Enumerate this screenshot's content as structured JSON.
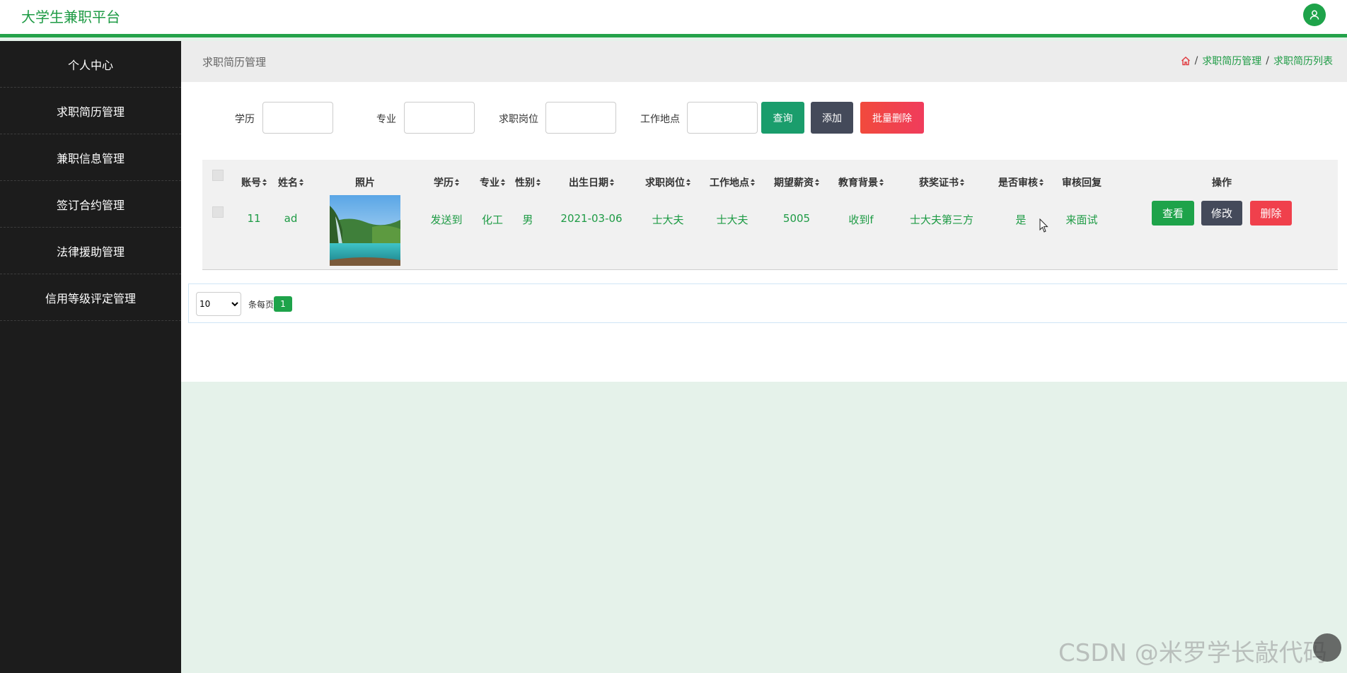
{
  "app": {
    "title": "大学生兼职平台"
  },
  "icons": {
    "avatar": "user-icon",
    "home": "home-icon"
  },
  "colors": {
    "accent": "#1ea34a",
    "sidebar": "#1c1c1c",
    "query": "#1a9d6c",
    "add": "#444a5a",
    "danger": "#f0404c"
  },
  "sidebar": {
    "items": [
      {
        "label": "个人中心"
      },
      {
        "label": "求职简历管理"
      },
      {
        "label": "兼职信息管理"
      },
      {
        "label": "签订合约管理"
      },
      {
        "label": "法律援助管理"
      },
      {
        "label": "信用等级评定管理"
      }
    ]
  },
  "breadcrumb": {
    "page_title": "求职简历管理",
    "level1": "求职简历管理",
    "level2": "求职简历列表",
    "sep": "/"
  },
  "search": {
    "f1_label": "学历",
    "f2_label": "专业",
    "f3_label": "求职岗位",
    "f4_label": "工作地点",
    "query_label": "查询",
    "add_label": "添加",
    "batch_delete_label": "批量删除"
  },
  "table": {
    "headers": {
      "account": "账号",
      "name": "姓名",
      "photo": "照片",
      "education": "学历",
      "major": "专业",
      "gender": "性别",
      "birth": "出生日期",
      "position": "求职岗位",
      "location": "工作地点",
      "salary": "期望薪资",
      "edu_bg": "教育背景",
      "cert": "获奖证书",
      "audited": "是否审核",
      "reply": "审核回复",
      "actions": "操作"
    },
    "rows": [
      {
        "account": "11",
        "name": "ad",
        "education": "发送到",
        "major": "化工",
        "gender": "男",
        "birth": "2021-03-06",
        "position": "士大夫",
        "location": "士大夫",
        "salary": "5005",
        "edu_bg": "收到f",
        "cert": "士大夫第三方",
        "audited": "是",
        "reply": "来面试",
        "view_label": "查看",
        "edit_label": "修改",
        "delete_label": "删除"
      }
    ]
  },
  "pagination": {
    "page_size": "10",
    "per_page_label": "条每页",
    "current_page": "1"
  },
  "watermark": "CSDN @米罗学长敲代码"
}
